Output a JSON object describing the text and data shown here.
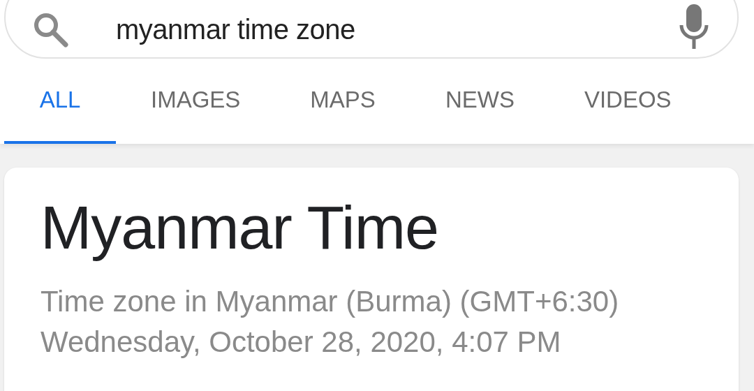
{
  "search": {
    "value": "myanmar time zone"
  },
  "tabs": [
    {
      "label": "ALL",
      "selected": true
    },
    {
      "label": "IMAGES",
      "selected": false
    },
    {
      "label": "MAPS",
      "selected": false
    },
    {
      "label": "NEWS",
      "selected": false
    },
    {
      "label": "VIDEOS",
      "selected": false
    }
  ],
  "result": {
    "title": "Myanmar Time",
    "lines": [
      "Time zone in Myanmar (Burma) (GMT+6:30)",
      "Wednesday, October 28, 2020, 4:07 PM"
    ]
  }
}
